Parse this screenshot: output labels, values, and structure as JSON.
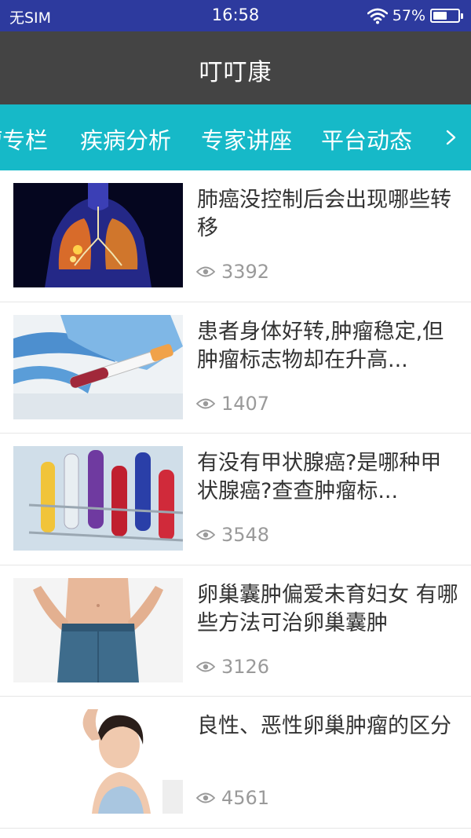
{
  "status_bar": {
    "carrier": "无SIM",
    "time": "16:58",
    "battery": "57%",
    "battery_level": 0.57,
    "icons": [
      "wifi-icon",
      "battery-icon"
    ]
  },
  "header": {
    "title": "叮叮康"
  },
  "tabs": {
    "items": [
      {
        "label": "瘤专栏"
      },
      {
        "label": "疾病分析"
      },
      {
        "label": "专家讲座"
      },
      {
        "label": "平台动态"
      }
    ],
    "more_icon": "chevron-right-icon",
    "color": "#16b9c8"
  },
  "articles": [
    {
      "title": "肺癌没控制后会出现哪些转移",
      "views": "3392",
      "image": "lung-xray-image"
    },
    {
      "title": "患者身体好转,肿瘤稳定,但肿瘤标志物却在升高...",
      "views": "1407",
      "image": "blood-test-tube-image"
    },
    {
      "title": "有没有甲状腺癌?是哪种甲状腺癌?查查肿瘤标...",
      "views": "3548",
      "image": "test-tubes-rack-image"
    },
    {
      "title": "卵巢囊肿偏爱未育妇女 有哪些方法可治卵巢囊肿",
      "views": "3126",
      "image": "woman-waist-image"
    },
    {
      "title": "良性、恶性卵巢肿瘤的区分",
      "views": "4561",
      "image": "woman-portrait-image"
    }
  ],
  "colors": {
    "status_bar": "#2d3a9e",
    "app_bar": "#444444",
    "tab_bar": "#16b9c8",
    "meta_text": "#9a9a9a"
  }
}
